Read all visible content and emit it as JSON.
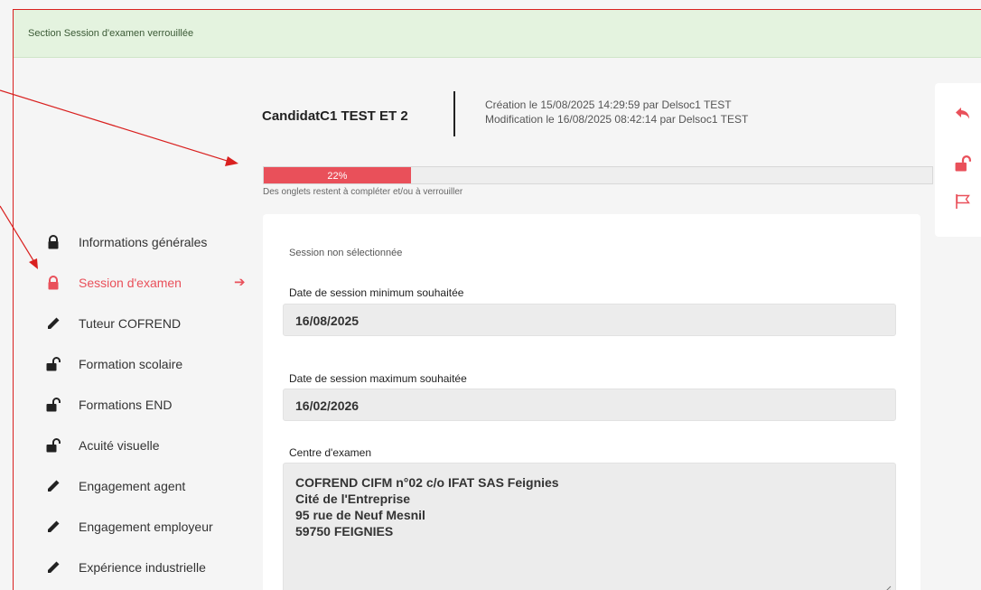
{
  "banner": {
    "text": "Section Session d'examen verrouillée"
  },
  "header": {
    "candidate": "CandidatC1 TEST ET 2",
    "created": "Création le 15/08/2025 14:29:59 par Delsoc1 TEST",
    "modified": "Modification le 16/08/2025 08:42:14 par Delsoc1 TEST"
  },
  "progress": {
    "percent": 22,
    "label": "22%",
    "caption": "Des onglets restent à compléter et/ou à verrouiller",
    "color": "#e9505a"
  },
  "sidebar": {
    "items": [
      {
        "label": "Informations générales",
        "icon": "lock-icon"
      },
      {
        "label": "Session d'examen",
        "icon": "lock-icon",
        "active": true
      },
      {
        "label": "Tuteur COFREND",
        "icon": "pencil-icon"
      },
      {
        "label": "Formation scolaire",
        "icon": "unlock-icon"
      },
      {
        "label": "Formations END",
        "icon": "unlock-icon"
      },
      {
        "label": "Acuité visuelle",
        "icon": "unlock-icon"
      },
      {
        "label": "Engagement agent",
        "icon": "pencil-icon"
      },
      {
        "label": "Engagement employeur",
        "icon": "pencil-icon"
      },
      {
        "label": "Expérience industrielle",
        "icon": "pencil-icon"
      }
    ]
  },
  "form": {
    "status": "Session non sélectionnée",
    "min_date_label": "Date de session minimum souhaitée",
    "min_date_value": "16/08/2025",
    "max_date_label": "Date de session maximum souhaitée",
    "max_date_value": "16/02/2026",
    "center_label": "Centre d'examen",
    "center_lines": [
      "COFREND CIFM n°02 c/o IFAT SAS Feignies",
      "Cité de l'Entreprise",
      "95 rue de Neuf Mesnil",
      "59750 FEIGNIES"
    ]
  },
  "rail": {
    "icons": [
      "reply-icon",
      "unlock-icon",
      "flag-icon"
    ]
  },
  "colors": {
    "accent": "#e9505a",
    "banner_bg": "#e4f3df",
    "annotation": "#d9201f"
  }
}
